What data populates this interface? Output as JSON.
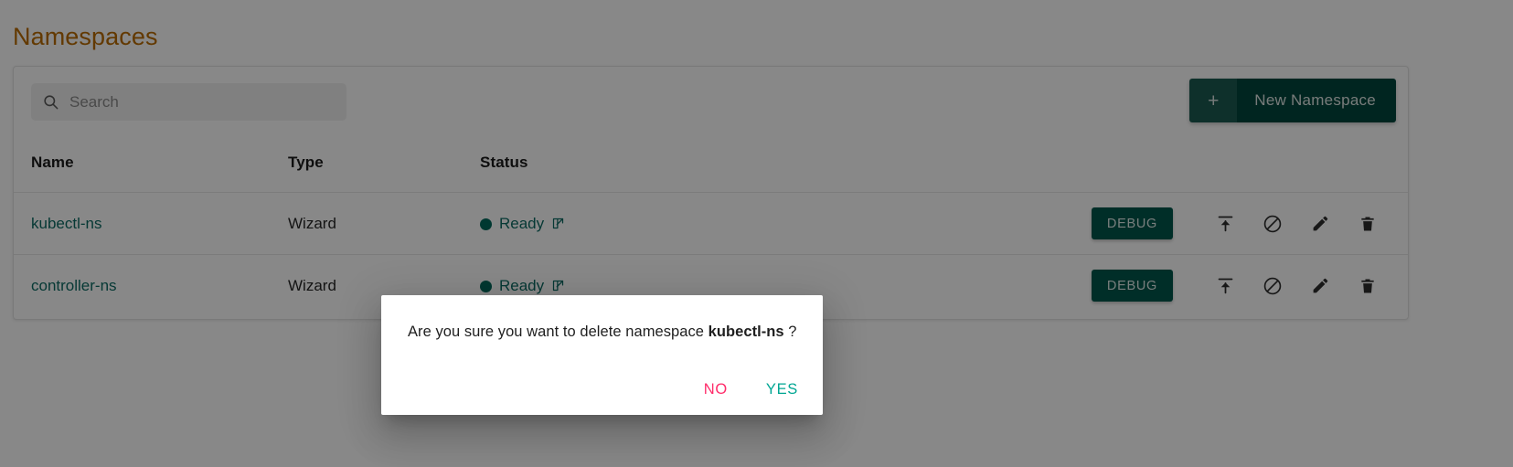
{
  "page": {
    "title": "Namespaces"
  },
  "toolbar": {
    "search": {
      "placeholder": "Search",
      "value": "",
      "icon": "search-icon"
    },
    "new_namespace": {
      "plus_label": "+",
      "label": "New Namespace",
      "bg_color": "#00463c",
      "plus_bg_color": "#1b5b52"
    }
  },
  "table": {
    "columns": [
      "Name",
      "Type",
      "Status"
    ],
    "rows": [
      {
        "name": "kubectl-ns",
        "type": "Wizard",
        "status": "Ready",
        "status_color": "#00695c",
        "status_link_icon": "external-link-icon",
        "actions": {
          "debug_label": "DEBUG",
          "icons": [
            "upload-icon",
            "ban-icon",
            "pencil-icon",
            "trash-icon"
          ]
        }
      },
      {
        "name": "controller-ns",
        "type": "Wizard",
        "status": "Ready",
        "status_color": "#00695c",
        "status_link_icon": "external-link-icon",
        "actions": {
          "debug_label": "DEBUG",
          "icons": [
            "upload-icon",
            "ban-icon",
            "pencil-icon",
            "trash-icon"
          ]
        }
      }
    ]
  },
  "dialog": {
    "message_prefix": "Are you sure you want to delete namespace ",
    "target": "kubectl-ns",
    "message_suffix": " ?",
    "no_label": "NO",
    "yes_label": "YES",
    "no_color": "#ff2d6b",
    "yes_color": "#00a693"
  },
  "colors": {
    "title": "#b96b00",
    "accent_teal": "#0d6b64",
    "overlay": "rgba(0,0,0,0.465)"
  }
}
